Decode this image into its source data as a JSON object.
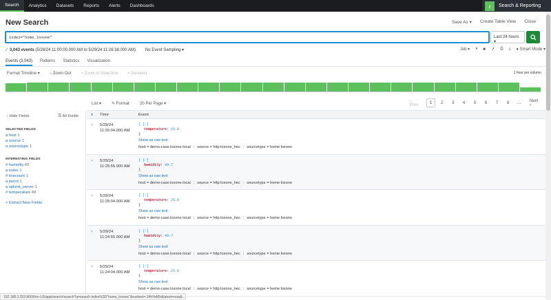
{
  "nav": {
    "items": [
      "Search",
      "Analytics",
      "Datasets",
      "Reports",
      "Alerts",
      "Dashboards"
    ],
    "app_name": "Search & Reporting"
  },
  "page": {
    "title": "New Search",
    "links": [
      "Save As ▾",
      "Create Table View",
      "Close"
    ]
  },
  "search": {
    "query": "index=\"home_loxone\"",
    "time_range": "Last 24 hours ▾"
  },
  "status": {
    "events": "3,043 events",
    "range": "(5/28/24 11:00:00.000 AM to 5/29/24 11:26:38.000 AM)",
    "sampling": "No Event Sampling ▾",
    "job": "Job ▾",
    "mode": "Smart Mode ▾"
  },
  "tabs": [
    "Events (3,043)",
    "Patterns",
    "Statistics",
    "Visualization"
  ],
  "timeline_bar": {
    "format": "Format Timeline ▾",
    "zoom_out": "– Zoom Out",
    "zoom_sel": "+ Zoom to Selection",
    "deselect": "× Deselect",
    "scale": "1 hour per column"
  },
  "timeline_levels": [
    0.8,
    0.85,
    0.85,
    0.85,
    0.85,
    0.85,
    0.85,
    0.85,
    0.85,
    0.85,
    0.85,
    0.85,
    0.85,
    0.85,
    0.85,
    0.85,
    0.85,
    0.85,
    0.85,
    0.85,
    0.85,
    0.85,
    0.85,
    0.85,
    0.4
  ],
  "list_tools": {
    "list": "List ▾",
    "format": "✎ Format",
    "per_page": "20 Per Page ▾"
  },
  "pager": {
    "prev": "‹ Prev",
    "pages": [
      "1",
      "2",
      "3",
      "4",
      "5",
      "6",
      "7",
      "8",
      "…"
    ],
    "next": "Next ›"
  },
  "sidebar": {
    "hide": "‹ Hide Fields",
    "all": "☰ All Fields",
    "selected_title": "SELECTED FIELDS",
    "selected": [
      {
        "name": "a host",
        "count": "1"
      },
      {
        "name": "a source",
        "count": "1"
      },
      {
        "name": "a sourcetype",
        "count": "1"
      }
    ],
    "interesting_title": "INTERESTING FIELDS",
    "interesting": [
      {
        "name": "# humidity",
        "count": "65"
      },
      {
        "name": "a index",
        "count": "1"
      },
      {
        "name": "# linecount",
        "count": "1"
      },
      {
        "name": "a punct",
        "count": "1"
      },
      {
        "name": "a splunk_server",
        "count": "1"
      },
      {
        "name": "# temperature",
        "count": "49"
      }
    ],
    "extract": "+ Extract New Fields"
  },
  "table": {
    "headers": [
      "i",
      "Time",
      "Event"
    ],
    "rows": [
      {
        "date": "5/29/24",
        "time": "11:26:04.000 AM",
        "key": "temperature",
        "val": "25.8"
      },
      {
        "date": "5/29/24",
        "time": "11:25:55.000 AM",
        "key": "humidity",
        "val": "49.7"
      },
      {
        "date": "5/29/24",
        "time": "11:25:04.000 AM",
        "key": "temperature",
        "val": "25.8"
      },
      {
        "date": "5/29/24",
        "time": "11:24:55.000 AM",
        "key": "humidity",
        "val": "49.7"
      },
      {
        "date": "5/29/24",
        "time": "11:24:04.000 AM",
        "key": "temperature",
        "val": "25.8"
      }
    ],
    "brace_open": "{ [-]",
    "brace_close": "}",
    "raw_link": "Show as raw text",
    "host": "host = demo-case.loxone.local",
    "source": "source = http:loxone_hec",
    "sourcetype": "sourcetype = home:loxone"
  },
  "url_status": "192.168.3.252:8000/en-US/app/search/search?q=search index%3D\"home_loxone\"&earliest=-24h%40h&latest=now&..."
}
